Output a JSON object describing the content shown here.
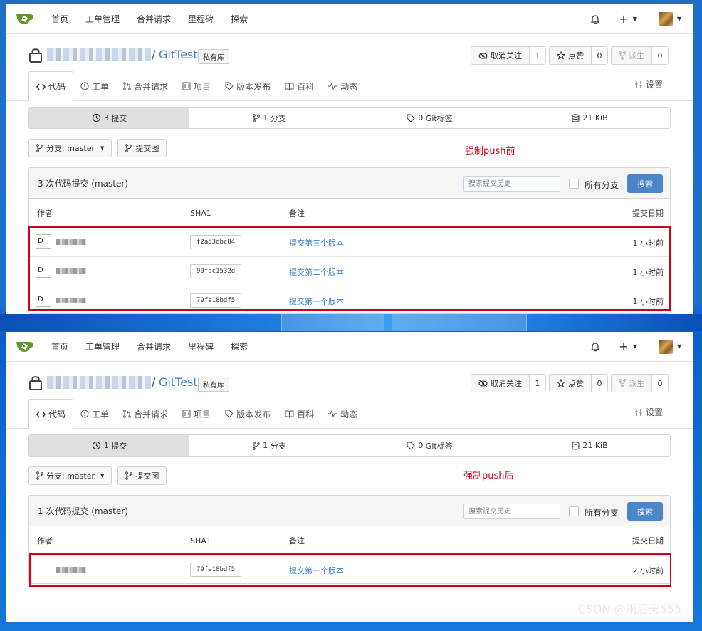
{
  "nav": {
    "home": "首页",
    "issues": "工单管理",
    "pulls": "合并请求",
    "milestones": "里程碑",
    "explore": "探索",
    "plus": "+"
  },
  "repo": {
    "slash": "/",
    "name": "GitTest",
    "private_badge": "私有库"
  },
  "actions": {
    "unwatch": "取消关注",
    "watch_count": "1",
    "star": "点赞",
    "star_count": "0",
    "fork": "派生",
    "fork_count": "0"
  },
  "tabs": [
    "代码",
    "工单",
    "合并请求",
    "项目",
    "版本发布",
    "百科",
    "动态"
  ],
  "settings_label": "设置",
  "stats_unit": {
    "commits": "提交",
    "branches": "分支",
    "tags": "Git标签"
  },
  "branch_selector": "分支: master",
  "commit_graph": "提交图",
  "search": {
    "placeholder": "搜索提交历史",
    "all_branches": "所有分支",
    "button": "搜索"
  },
  "columns": {
    "author": "作者",
    "sha": "SHA1",
    "message": "备注",
    "date": "提交日期"
  },
  "avatar_alt": "D",
  "before": {
    "annotation": "强制push前",
    "commit_count": "3",
    "branch_count": "1",
    "tag_count": "0",
    "size": "21 KiB",
    "title": "3 次代码提交 (master)",
    "rows": [
      {
        "sha": "f2a53dbc84",
        "message": "提交第三个版本",
        "date": "1 小时前"
      },
      {
        "sha": "90fdc1532d",
        "message": "提交第二个版本",
        "date": "1 小时前"
      },
      {
        "sha": "79fe18bdf5",
        "message": "提交第一个版本",
        "date": "1 小时前"
      }
    ]
  },
  "after": {
    "annotation": "强制push后",
    "commit_count": "1",
    "branch_count": "1",
    "tag_count": "0",
    "size": "21 KiB",
    "title": "1 次代码提交 (master)",
    "rows": [
      {
        "sha": "79fe18bdf5",
        "message": "提交第一个版本",
        "date": "2 小时前"
      }
    ]
  },
  "watermark": "CSDN @雨后天555"
}
